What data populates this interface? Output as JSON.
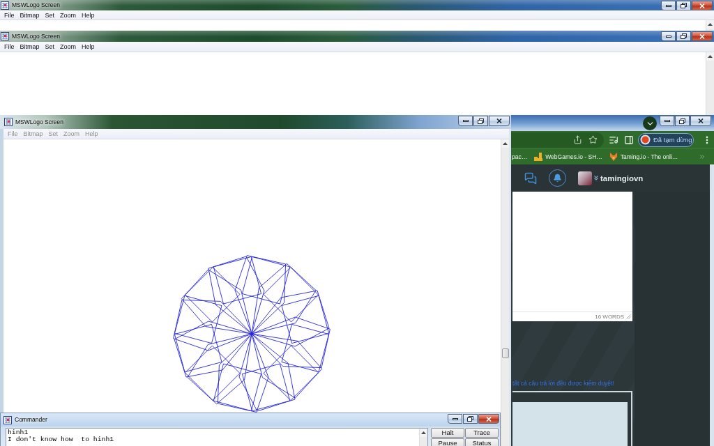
{
  "windows": [
    {
      "kind": "blank",
      "title": "MSWLogo Screen",
      "active": true,
      "menu": [
        {
          "label": "File",
          "disabled": false
        },
        {
          "label": "Bitmap",
          "disabled": false
        },
        {
          "label": "Set",
          "disabled": false
        },
        {
          "label": "Zoom",
          "disabled": false
        },
        {
          "label": "Help",
          "disabled": false
        }
      ]
    },
    {
      "kind": "blank",
      "title": "MSWLogo Screen",
      "active": true,
      "menu": [
        {
          "label": "File",
          "disabled": false
        },
        {
          "label": "Bitmap",
          "disabled": false
        },
        {
          "label": "Set",
          "disabled": false
        },
        {
          "label": "Zoom",
          "disabled": false
        },
        {
          "label": "Help",
          "disabled": false
        }
      ]
    },
    {
      "kind": "drawing",
      "title": "MSWLogo Screen",
      "active": false,
      "menu": [
        {
          "label": "File",
          "disabled": true
        },
        {
          "label": "Bitmap",
          "disabled": true
        },
        {
          "label": "Set",
          "disabled": true
        },
        {
          "label": "Zoom",
          "disabled": true
        },
        {
          "label": "Help",
          "disabled": true
        }
      ]
    }
  ],
  "browser": {
    "active": false,
    "profile": "Đã tạm dừng",
    "bookmarks": [
      {
        "kind": "text",
        "label": "pac…"
      },
      {
        "kind": "blocks",
        "label": "WebGames.io - SH…"
      },
      {
        "kind": "fox",
        "label": "Taming.io - The onli…"
      }
    ],
    "username": "tamingiovn",
    "word_count": "16 WORDS",
    "notice": "tất cả câu trả lời đều được kiểm duyệt!"
  },
  "commander": {
    "title": "Commander",
    "active": true,
    "output": [
      "hinh1",
      "I don't know how  to hinh1"
    ],
    "buttons": [
      "Halt",
      "Trace",
      "Pause",
      "Status"
    ]
  }
}
